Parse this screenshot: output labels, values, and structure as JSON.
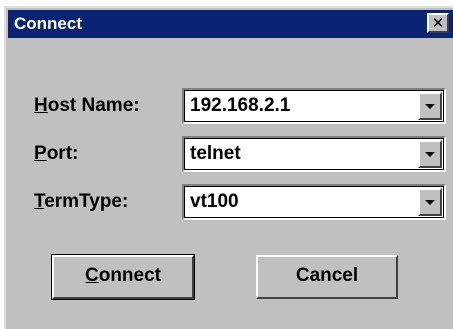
{
  "window": {
    "title": "Connect",
    "close_glyph": "✕"
  },
  "fields": {
    "host": {
      "label_mnemonic": "H",
      "label_rest": "ost Name:",
      "value": "192.168.2.1"
    },
    "port": {
      "label_mnemonic": "P",
      "label_rest": "ort:",
      "value": "telnet"
    },
    "termtype": {
      "label_mnemonic": "T",
      "label_rest": "ermType:",
      "value": "vt100"
    }
  },
  "buttons": {
    "connect": {
      "label_mnemonic": "C",
      "label_rest": "onnect"
    },
    "cancel": {
      "label": "Cancel"
    }
  },
  "icons": {
    "close": "close-icon",
    "dropdown": "chevron-down-icon"
  },
  "colors": {
    "titlebar": "#0a2472",
    "face": "#c0c0c0"
  }
}
